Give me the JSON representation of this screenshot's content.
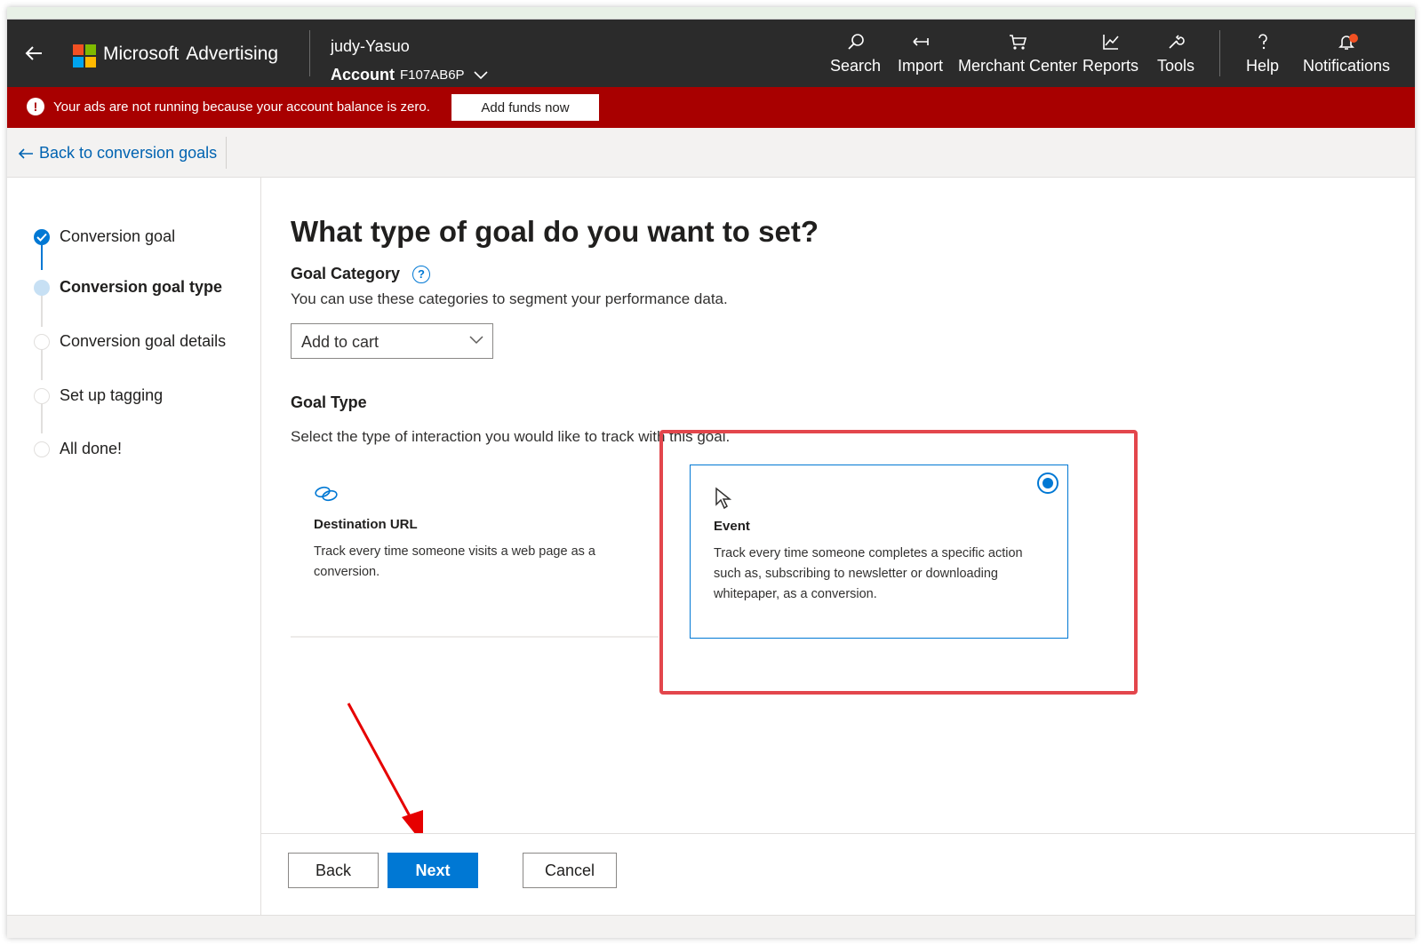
{
  "colors": {
    "topbar": "#2b2b2b",
    "alert": "#a80000",
    "accent": "#0078d4",
    "link": "#0063b1",
    "annotation": "#e3464c",
    "logo": [
      "#f25022",
      "#7fba00",
      "#00a4ef",
      "#ffb900"
    ]
  },
  "header": {
    "brand_name": "Microsoft",
    "brand_product": "Advertising",
    "user_name": "judy-Yasuo",
    "account_label": "Account",
    "account_id": "F107AB6P",
    "nav": [
      {
        "label": "Search",
        "icon": "search-icon"
      },
      {
        "label": "Import",
        "icon": "import-icon"
      },
      {
        "label": "Merchant Center",
        "icon": "cart-icon"
      },
      {
        "label": "Reports",
        "icon": "chart-icon"
      },
      {
        "label": "Tools",
        "icon": "wrench-icon"
      },
      {
        "label": "Help",
        "icon": "help-icon"
      },
      {
        "label": "Notifications",
        "icon": "bell-icon"
      }
    ]
  },
  "alert": {
    "message": "Your ads are not running because your account balance is zero.",
    "button_label": "Add funds now"
  },
  "subnav": {
    "back_label": "Back to conversion goals"
  },
  "steps": [
    {
      "label": "Conversion goal",
      "state": "done"
    },
    {
      "label": "Conversion goal type",
      "state": "current"
    },
    {
      "label": "Conversion goal details",
      "state": "todo"
    },
    {
      "label": "Set up tagging",
      "state": "todo"
    },
    {
      "label": "All done!",
      "state": "todo"
    }
  ],
  "main": {
    "title": "What type of goal do you want to set?",
    "category_label": "Goal Category",
    "category_help": "?",
    "category_desc": "You can use these categories to segment your performance data.",
    "category_value": "Add to cart",
    "type_label": "Goal Type",
    "type_desc": "Select the type of interaction you would like to track with this goal.",
    "options": [
      {
        "title": "Destination URL",
        "desc": "Track every time someone visits a web page as a conversion.",
        "icon": "link-icon",
        "selected": false
      },
      {
        "title": "Event",
        "desc": "Track every time someone completes a specific action such as, subscribing to newsletter or downloading whitepaper, as a conversion.",
        "icon": "cursor-icon",
        "selected": true
      }
    ]
  },
  "footer": {
    "back_label": "Back",
    "next_label": "Next",
    "cancel_label": "Cancel"
  }
}
